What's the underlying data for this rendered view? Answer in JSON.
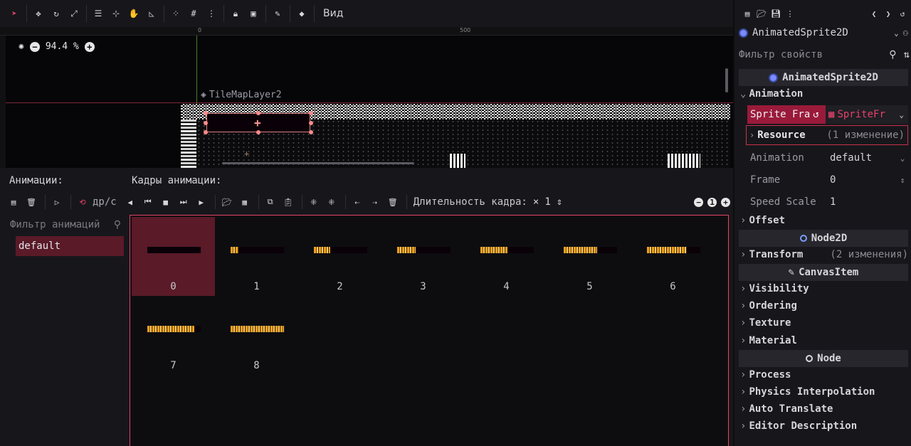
{
  "toolbar": {
    "view_menu": "Вид",
    "icons": [
      "select-icon",
      "move-icon",
      "rotate-icon",
      "scale-icon",
      "list-select-icon",
      "pivot-icon",
      "pan-icon",
      "ruler-icon",
      "snap-icon",
      "grid-snap-icon",
      "more-icon",
      "lock-icon",
      "group-icon",
      "bone-icon",
      "skeleton-icon"
    ]
  },
  "viewport": {
    "ruler_marks": [
      "0",
      "500"
    ],
    "zoom": "94.4 %",
    "layer_label": "TileMapLayer2"
  },
  "animations_panel": {
    "animations_title": "Анимации:",
    "frames_title": "Кадры анимации:",
    "fps_label": "др/с",
    "duration_label": "Длительность кадра:",
    "duration_prefix": "×",
    "duration_value": "1",
    "filter_placeholder": "Фильтр анимаций",
    "animations": [
      "default"
    ],
    "frames": [
      {
        "index": "0",
        "fill": 0.0
      },
      {
        "index": "1",
        "fill": 0.14
      },
      {
        "index": "2",
        "fill": 0.3
      },
      {
        "index": "3",
        "fill": 0.34
      },
      {
        "index": "4",
        "fill": 0.5
      },
      {
        "index": "5",
        "fill": 0.62
      },
      {
        "index": "6",
        "fill": 0.74
      },
      {
        "index": "7",
        "fill": 0.88
      },
      {
        "index": "8",
        "fill": 1.0
      }
    ],
    "selected_frame": "0"
  },
  "inspector": {
    "node_name": "AnimatedSprite2D",
    "filter_placeholder": "Фильтр свойств",
    "class_header": "AnimatedSprite2D",
    "animation_category": "Animation",
    "sprite_frames_label": "Sprite Fra",
    "sprite_frames_value": "SpriteFr",
    "resource_label": "Resource",
    "resource_note": "(1 изменение)",
    "properties": [
      {
        "name": "Animation",
        "value": "default"
      },
      {
        "name": "Frame",
        "value": "0"
      },
      {
        "name": "Speed Scale",
        "value": "1"
      }
    ],
    "offset_category": "Offset",
    "node2d_header": "Node2D",
    "transform_category": "Transform",
    "transform_note": "(2 изменения)",
    "canvasitem_header": "CanvasItem",
    "canvas_categories": [
      "Visibility",
      "Ordering",
      "Texture",
      "Material"
    ],
    "node_header": "Node",
    "node_categories": [
      "Process",
      "Physics Interpolation",
      "Auto Translate",
      "Editor Description"
    ]
  },
  "colors": {
    "accent": "#e8416a",
    "selected_bg": "#5a1a28",
    "panel_bg": "#17171b"
  }
}
